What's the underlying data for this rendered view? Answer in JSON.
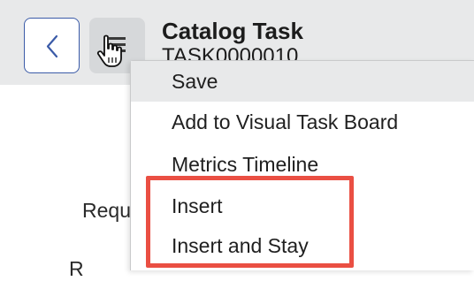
{
  "header": {
    "back_icon": "chevron-left-icon",
    "context_menu_icon": "hamburger-menu-icon",
    "title": "Catalog Task",
    "record_number": "TASK0000010"
  },
  "form": {
    "labels": [
      "Requ",
      "R"
    ]
  },
  "context_menu": {
    "items": [
      "Save",
      "Add to Visual Task Board",
      "Metrics Timeline",
      "Insert",
      "Insert and Stay"
    ],
    "hovered_item": "Save"
  },
  "annotation": {
    "highlight_color": "#ea4f43",
    "highlighted_items": [
      "Insert",
      "Insert and Stay"
    ]
  },
  "colors": {
    "header_bg": "#e8e9ea",
    "accent_blue": "#3b5ba8",
    "menu_hover": "#e8e9ea"
  },
  "cursor": "hand-pointer-icon"
}
